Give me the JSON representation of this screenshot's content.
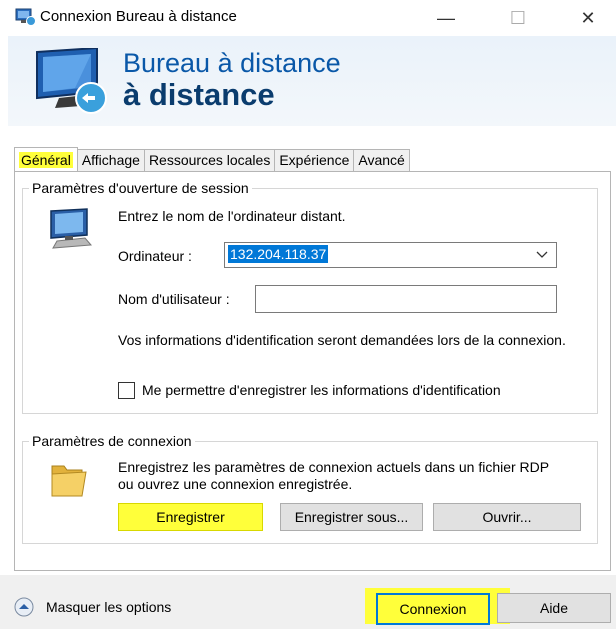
{
  "window": {
    "title": "Connexion Bureau à distance",
    "minimize": "—",
    "maximize": "☐",
    "close": "✕"
  },
  "banner": {
    "line1": "Bureau à distance",
    "line2": "à distance"
  },
  "tabs": [
    {
      "label": "Général",
      "active": true
    },
    {
      "label": "Affichage"
    },
    {
      "label": "Ressources locales"
    },
    {
      "label": "Expérience"
    },
    {
      "label": "Avancé"
    }
  ],
  "session": {
    "group_title": "Paramètres d'ouverture de session",
    "prompt": "Entrez le nom de l'ordinateur distant.",
    "computer_label": "Ordinateur :",
    "computer_value": "132.204.118.37",
    "username_label": "Nom d'utilisateur :",
    "username_value": "",
    "info_text": "Vos informations d'identification seront demandées lors de la connexion.",
    "save_credentials_label": "Me permettre d'enregistrer les informations d'identification",
    "save_credentials_checked": false
  },
  "connection": {
    "group_title": "Paramètres de connexion",
    "description": "Enregistrez les paramètres de connexion actuels dans un fichier RDP ou ouvrez une connexion enregistrée.",
    "save_button": "Enregistrer",
    "save_as_button": "Enregistrer sous...",
    "open_button": "Ouvrir..."
  },
  "footer": {
    "hide_options": "Masquer les options",
    "connect_button": "Connexion",
    "help_button": "Aide"
  },
  "colors": {
    "highlight": "#ffff3a",
    "banner_title": "#0a58a8",
    "selection": "#0078d7"
  }
}
